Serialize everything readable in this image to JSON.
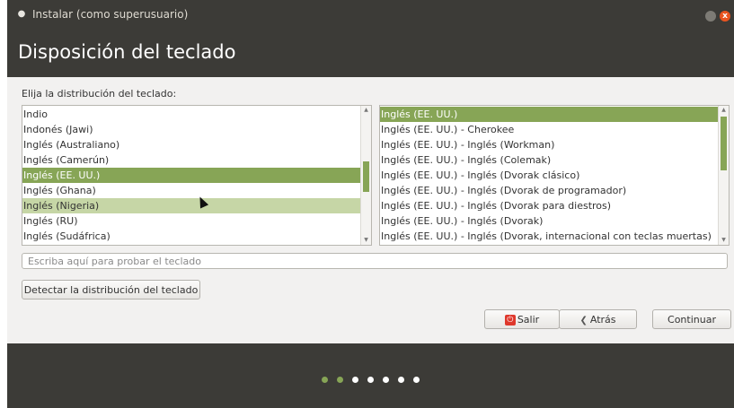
{
  "window": {
    "title": "Instalar (como superusuario)",
    "close_glyph": "x"
  },
  "header": {
    "title": "Disposición del teclado"
  },
  "prompt": "Elija la distribución del teclado:",
  "layouts_left": [
    {
      "label": "Indio",
      "state": "normal"
    },
    {
      "label": "Indonés (Jawi)",
      "state": "normal"
    },
    {
      "label": "Inglés (Australiano)",
      "state": "normal"
    },
    {
      "label": "Inglés (Camerún)",
      "state": "normal"
    },
    {
      "label": "Inglés (EE. UU.)",
      "state": "selected"
    },
    {
      "label": "Inglés (Ghana)",
      "state": "normal"
    },
    {
      "label": "Inglés (Nigeria)",
      "state": "hover"
    },
    {
      "label": "Inglés (RU)",
      "state": "normal"
    },
    {
      "label": "Inglés (Sudáfrica)",
      "state": "normal"
    }
  ],
  "layouts_right": [
    {
      "label": "Inglés (EE. UU.)",
      "state": "selected"
    },
    {
      "label": "Inglés (EE. UU.) - Cherokee",
      "state": "normal"
    },
    {
      "label": "Inglés (EE. UU.) - Inglés (Workman)",
      "state": "normal"
    },
    {
      "label": "Inglés (EE. UU.) - Inglés (Colemak)",
      "state": "normal"
    },
    {
      "label": "Inglés (EE. UU.) - Inglés (Dvorak clásico)",
      "state": "normal"
    },
    {
      "label": "Inglés (EE. UU.) - Inglés (Dvorak de programador)",
      "state": "normal"
    },
    {
      "label": "Inglés (EE. UU.) - Inglés (Dvorak para diestros)",
      "state": "normal"
    },
    {
      "label": "Inglés (EE. UU.) - Inglés (Dvorak)",
      "state": "normal"
    },
    {
      "label": "Inglés (EE. UU.) - Inglés (Dvorak, internacional con teclas muertas)",
      "state": "normal"
    }
  ],
  "test_input": {
    "placeholder": "Escriba aquí para probar el teclado",
    "value": ""
  },
  "buttons": {
    "detect": "Detectar la distribución del teclado",
    "quit": "Salir",
    "back": "Atrás",
    "continue": "Continuar"
  },
  "progress": {
    "total_steps": 7,
    "completed_steps": 2
  },
  "colors": {
    "accent": "#87a556",
    "hover": "#c6d6a6",
    "chrome": "#3c3b37",
    "close": "#e95420"
  }
}
